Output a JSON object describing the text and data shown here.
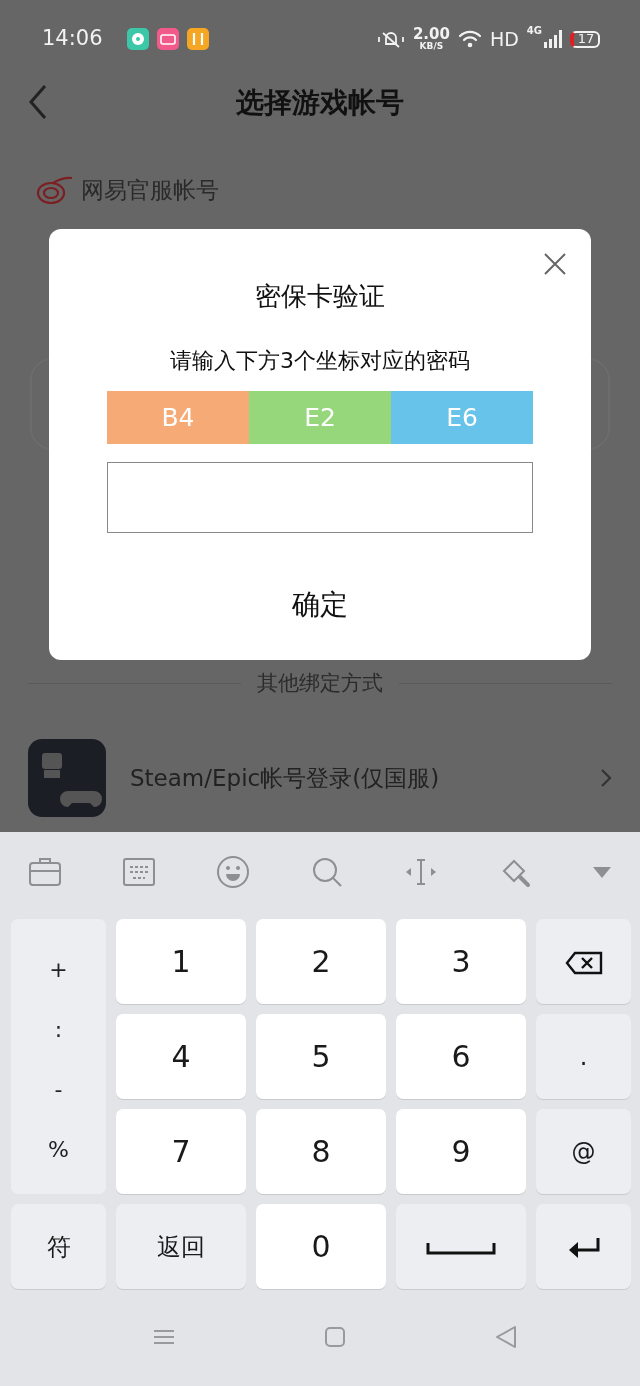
{
  "status_bar": {
    "time": "14:06",
    "net_speed": "2.00",
    "net_unit": "KB/S",
    "hd": "HD",
    "network": "4G",
    "battery": "17"
  },
  "header": {
    "title": "选择游戏帐号"
  },
  "account_section": {
    "label": "网易官服帐号"
  },
  "divider_label": "其他绑定方式",
  "bind_options": [
    {
      "label": "Steam/Epic帐号登录(仅国服)"
    }
  ],
  "dialog": {
    "title": "密保卡验证",
    "instruction": "请输入下方3个坐标对应的密码",
    "coordinates": [
      {
        "label": "B4",
        "color": "#f6ab76"
      },
      {
        "label": "E2",
        "color": "#97d77c"
      },
      {
        "label": "E6",
        "color": "#67c3e9"
      }
    ],
    "confirm": "确定"
  },
  "keyboard": {
    "symbols": [
      "+",
      ":",
      "-",
      "%"
    ],
    "keys": [
      {
        "label": "1",
        "kind": "digit"
      },
      {
        "label": "2",
        "kind": "digit"
      },
      {
        "label": "3",
        "kind": "digit"
      },
      {
        "kind": "backspace"
      },
      {
        "label": "4",
        "kind": "digit"
      },
      {
        "label": "5",
        "kind": "digit"
      },
      {
        "label": "6",
        "kind": "digit"
      },
      {
        "label": ".",
        "kind": "function"
      },
      {
        "label": "7",
        "kind": "digit"
      },
      {
        "label": "8",
        "kind": "digit"
      },
      {
        "label": "9",
        "kind": "digit"
      },
      {
        "label": "@",
        "kind": "function"
      },
      {
        "label": "符",
        "kind": "function"
      },
      {
        "label": "返回",
        "kind": "function"
      },
      {
        "label": "0",
        "kind": "digit"
      },
      {
        "kind": "space"
      },
      {
        "kind": "enter"
      }
    ]
  }
}
